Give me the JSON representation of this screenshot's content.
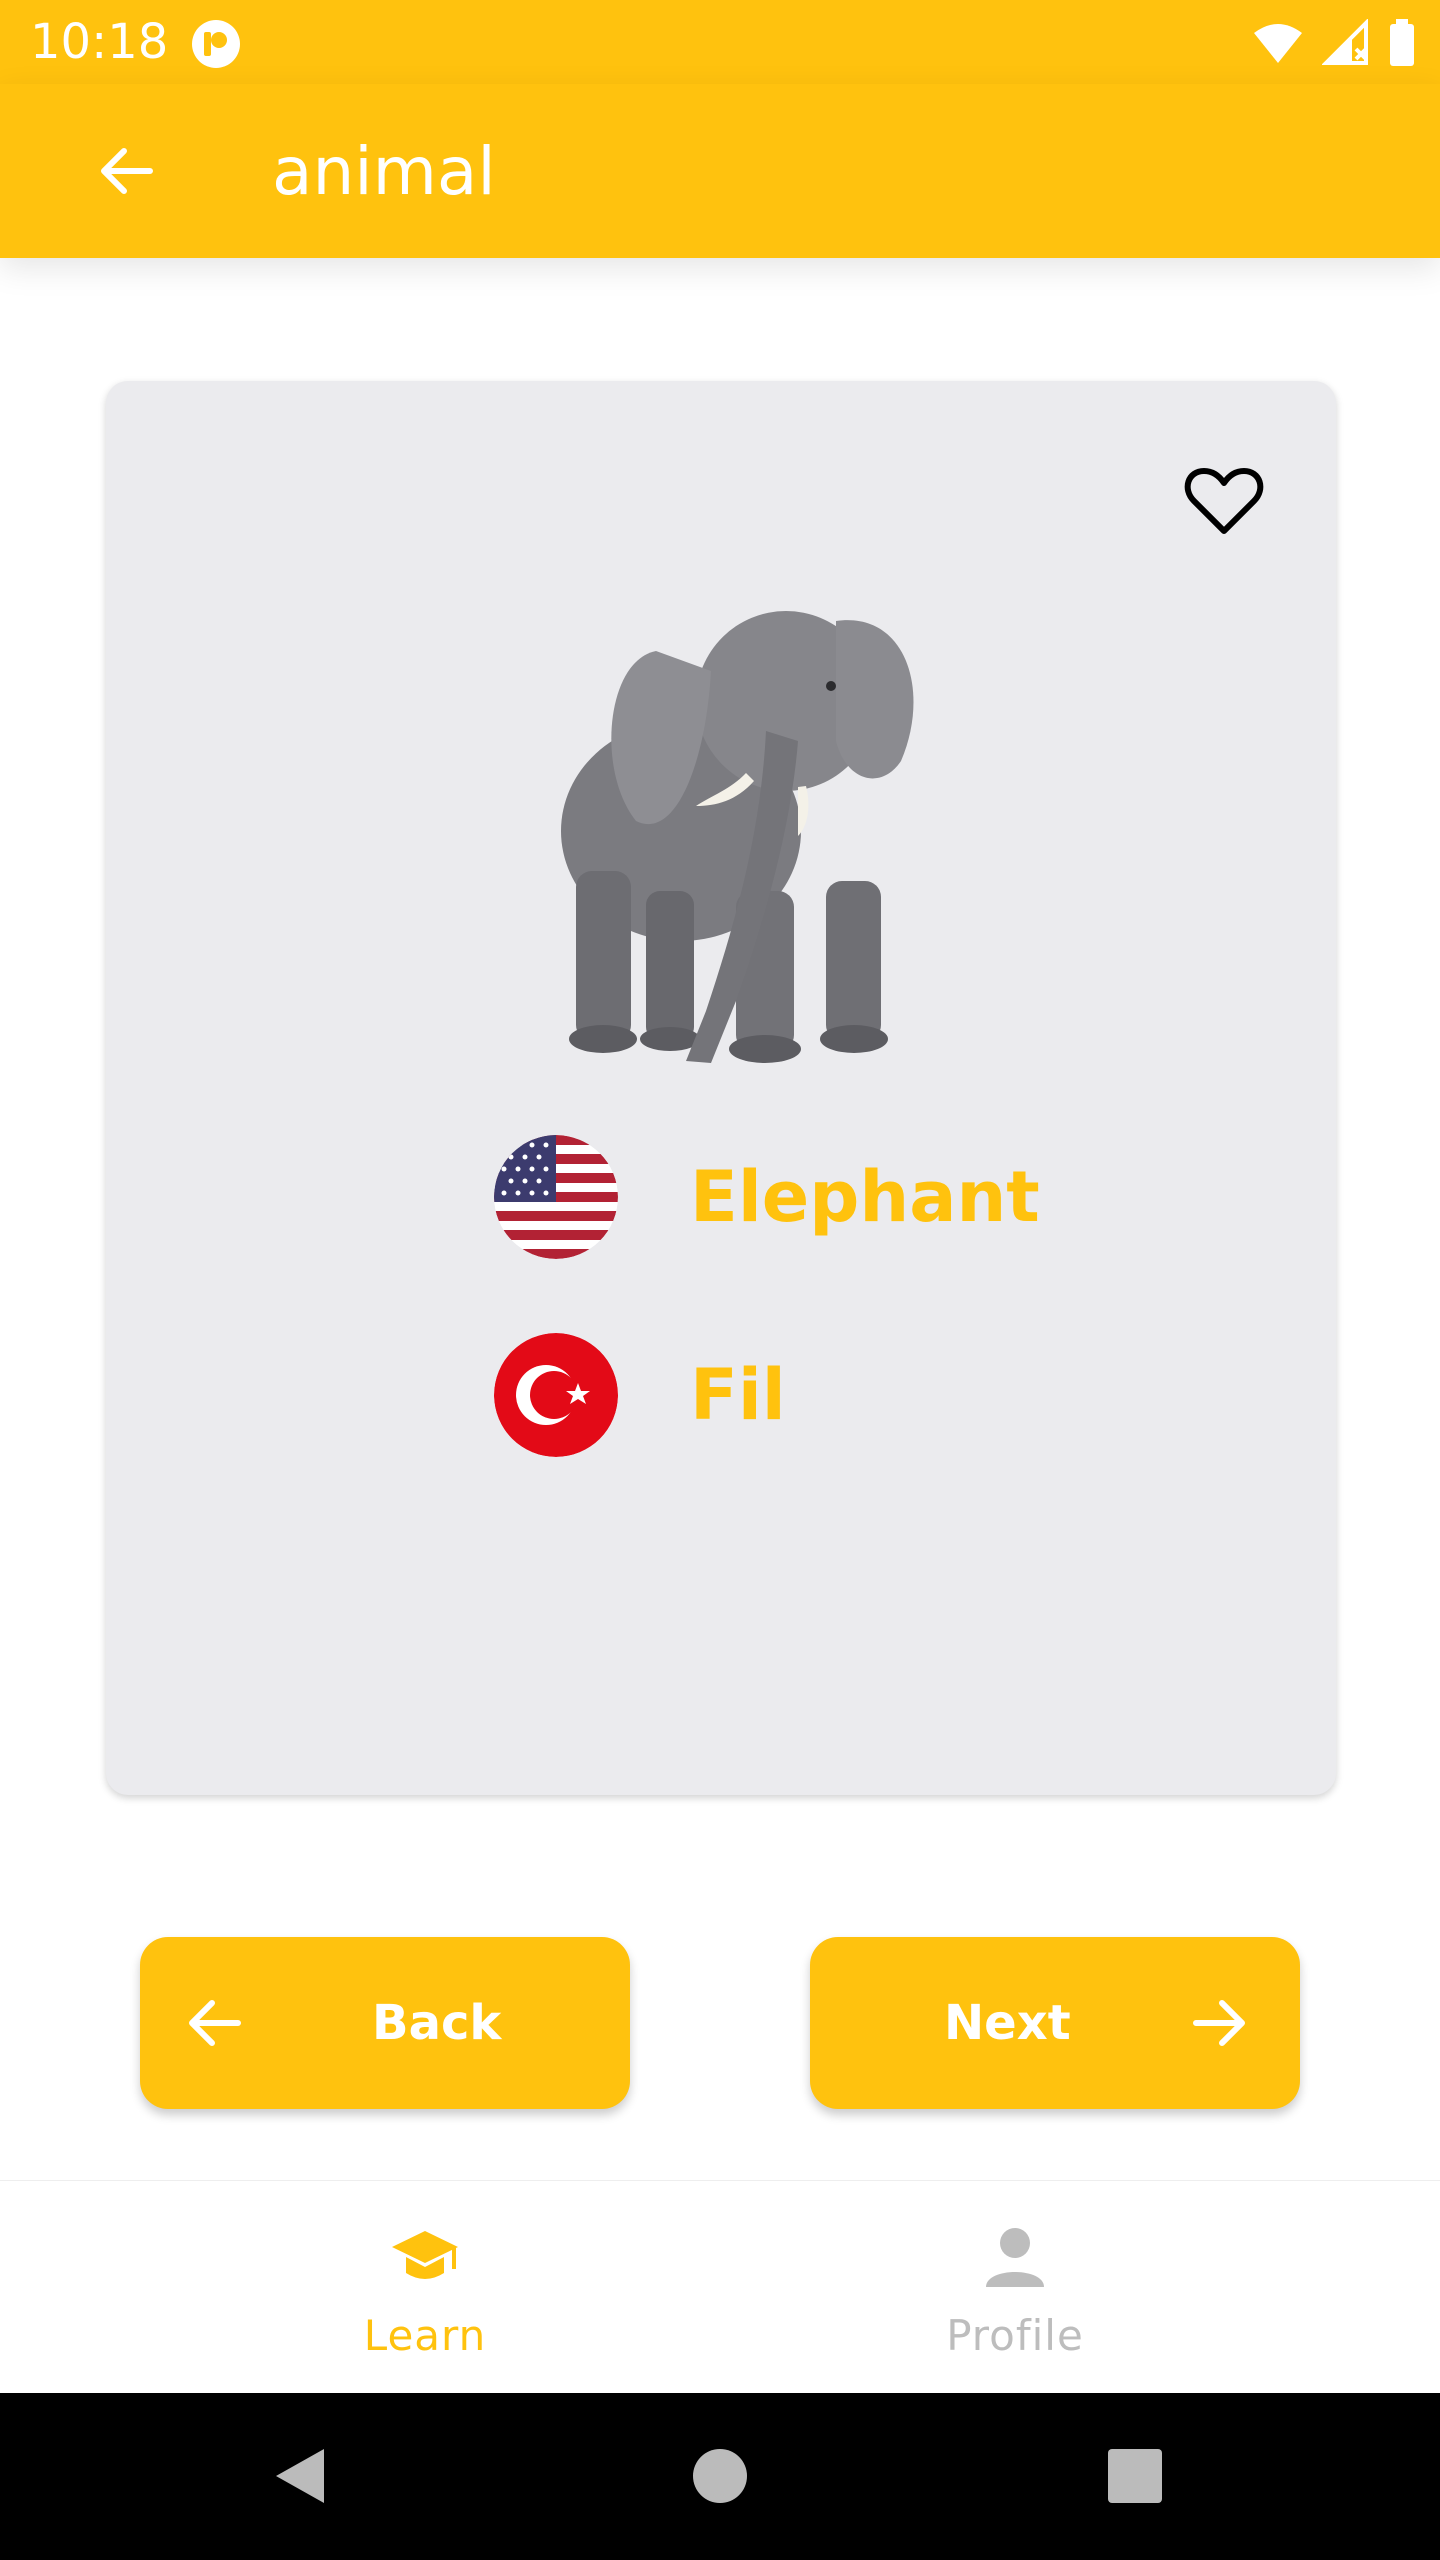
{
  "status_bar": {
    "time": "10:18"
  },
  "app_bar": {
    "title": "animal"
  },
  "card": {
    "image_icon": "elephant-image",
    "words": [
      {
        "flag": "us-flag",
        "text": "Elephant"
      },
      {
        "flag": "turkey-flag",
        "text": "Fil"
      }
    ]
  },
  "buttons": {
    "back_label": "Back",
    "next_label": "Next"
  },
  "bottom_nav": {
    "items": [
      {
        "label": "Learn",
        "icon": "graduation-cap-icon",
        "active": true
      },
      {
        "label": "Profile",
        "icon": "person-icon",
        "active": false
      }
    ]
  },
  "colors": {
    "accent": "#FFC20E",
    "card_bg": "#EBEBEE",
    "inactive": "#BDBDBD"
  }
}
